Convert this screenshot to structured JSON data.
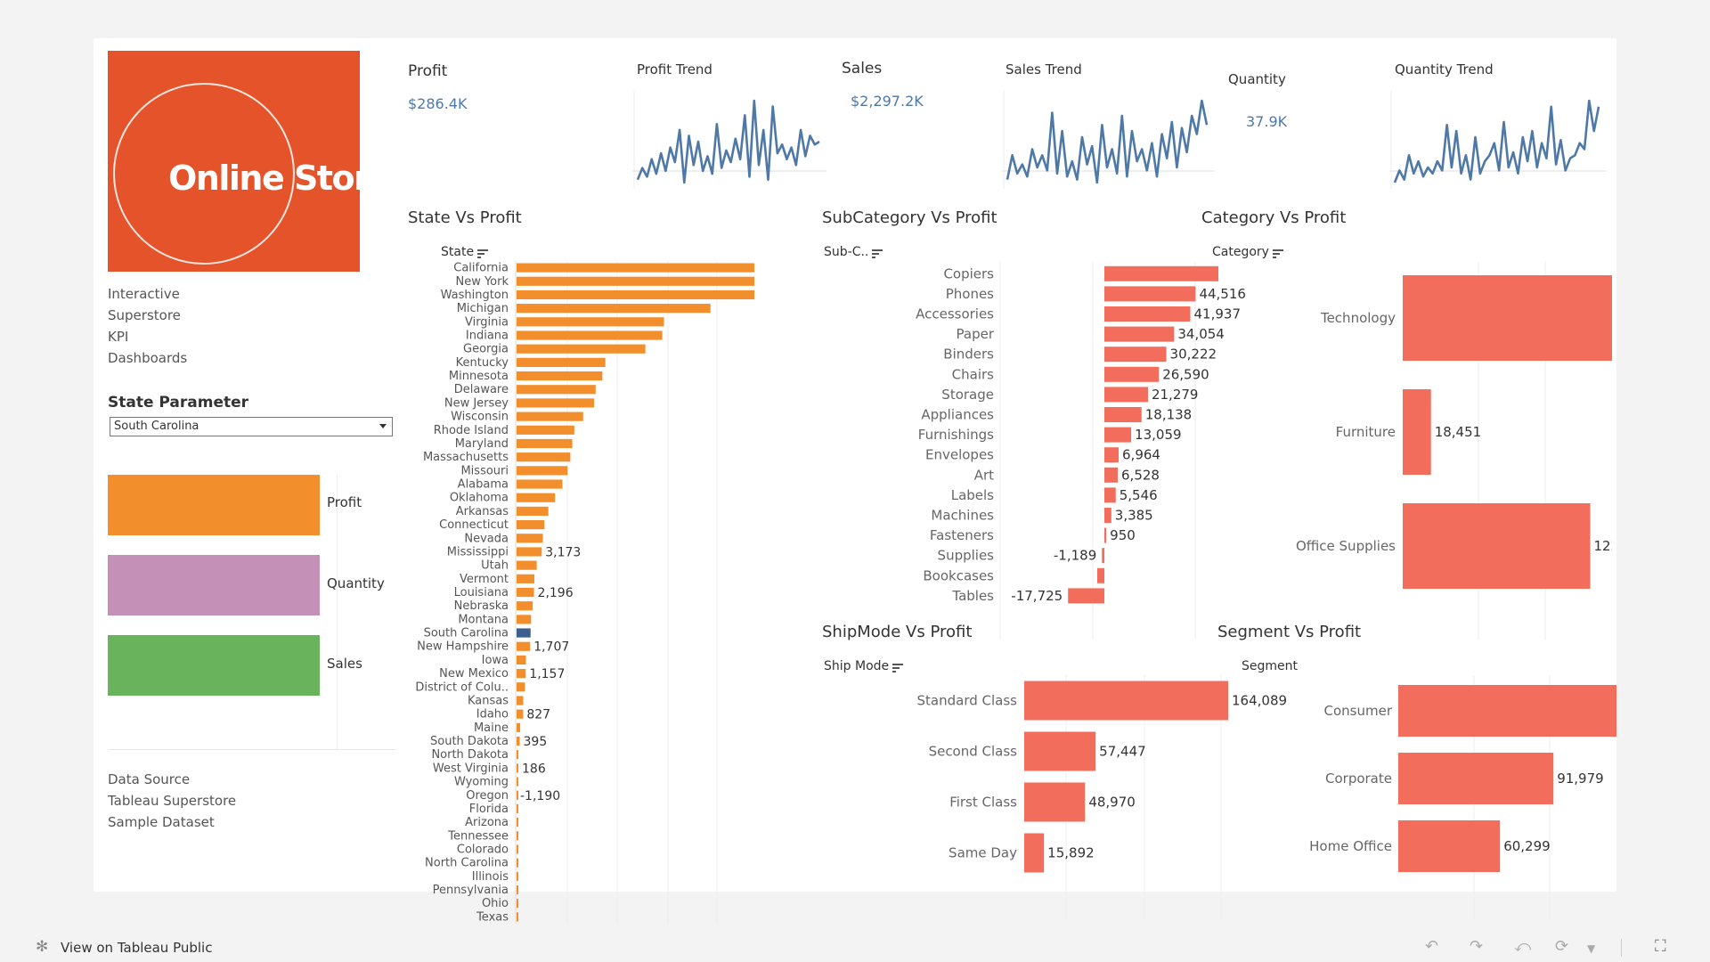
{
  "logo": {
    "text": "Online Store"
  },
  "description": [
    "Interactive",
    "Superstore",
    "KPI",
    "Dashboards"
  ],
  "state_parameter": {
    "title": "State Parameter",
    "selected": "South Carolina"
  },
  "legend": [
    {
      "label": "Profit",
      "color": "#f28e2b"
    },
    {
      "label": "Quantity",
      "color": "#c490b8"
    },
    {
      "label": "Sales",
      "color": "#6ab35d"
    }
  ],
  "data_source": [
    "Data Source",
    "Tableau Superstore",
    "Sample Dataset"
  ],
  "kpis": [
    {
      "title": "Profit",
      "value": "$286.4K",
      "trend_title": "Profit Trend"
    },
    {
      "title": "Sales",
      "value": "$2,297.2K",
      "trend_title": "Sales Trend"
    },
    {
      "title": "Quantity",
      "value": "37.9K",
      "trend_title": "Quantity Trend"
    }
  ],
  "colors": {
    "orange": "#f28e2b",
    "highlight": "#3b5f8f",
    "salmon": "#f26d5b",
    "trend": "#4e79a7"
  },
  "chart_data": [
    {
      "type": "bar",
      "title": "State Vs  Profit",
      "dimension": "State",
      "categories": [
        "California",
        "New York",
        "Washington",
        "Michigan",
        "Virginia",
        "Indiana",
        "Georgia",
        "Kentucky",
        "Minnesota",
        "Delaware",
        "New Jersey",
        "Wisconsin",
        "Rhode Island",
        "Maryland",
        "Massachusetts",
        "Missouri",
        "Alabama",
        "Oklahoma",
        "Arkansas",
        "Connecticut",
        "Nevada",
        "Mississippi",
        "Utah",
        "Vermont",
        "Louisiana",
        "Nebraska",
        "Montana",
        "South Carolina",
        "New Hampshire",
        "Iowa",
        "New Mexico",
        "District of Colu..",
        "Kansas",
        "Idaho",
        "Maine",
        "South Dakota",
        "North Dakota",
        "West Virginia",
        "Wyoming",
        "Oregon",
        "Florida",
        "Arizona",
        "Tennessee",
        "Colorado",
        "North Carolina",
        "Illinois",
        "Pennsylvania",
        "Ohio",
        "Texas"
      ],
      "values": [
        76381,
        74039,
        33403,
        24463,
        18598,
        18383,
        16250,
        11200,
        10823,
        9977,
        9773,
        8402,
        7286,
        7032,
        6786,
        6436,
        5787,
        4854,
        4009,
        3511,
        3317,
        3173,
        2547,
        2245,
        2196,
        2037,
        1834,
        1769,
        1707,
        1184,
        1157,
        1060,
        837,
        827,
        455,
        395,
        230,
        186,
        100,
        -1190,
        -3399,
        -3428,
        -5342,
        -6528,
        -7491,
        -12608,
        -15560,
        -16971,
        -25730
      ],
      "highlight": "South Carolina",
      "data_labels": {
        "Mississippi": "3,173",
        "Louisiana": "2,196",
        "New Hampshire": "1,707",
        "New Mexico": "1,157",
        "Idaho": "827",
        "South Dakota": "395",
        "West Virginia": "186",
        "Oregon": "-1,190"
      }
    },
    {
      "type": "bar",
      "title": "SubCategory Vs Profit",
      "dimension": "Sub-C..",
      "categories": [
        "Copiers",
        "Phones",
        "Accessories",
        "Paper",
        "Binders",
        "Chairs",
        "Storage",
        "Appliances",
        "Furnishings",
        "Envelopes",
        "Art",
        "Labels",
        "Machines",
        "Fasteners",
        "Supplies",
        "Bookcases",
        "Tables"
      ],
      "values": [
        55618,
        44516,
        41937,
        34054,
        30222,
        26590,
        21279,
        18138,
        13059,
        6964,
        6528,
        5546,
        3385,
        950,
        -1189,
        -3473,
        -17725
      ],
      "labels": [
        "",
        "44,516",
        "41,937",
        "34,054",
        "30,222",
        "26,590",
        "21,279",
        "18,138",
        "13,059",
        "6,964",
        "6,528",
        "5,546",
        "3,385",
        "950",
        "-1,189",
        "",
        "-17,725"
      ]
    },
    {
      "type": "bar",
      "title": "Category Vs Profit",
      "dimension": "Category",
      "categories": [
        "Technology",
        "Furniture",
        "Office Supplies"
      ],
      "values": [
        145455,
        18451,
        122491
      ],
      "labels": [
        "145,455",
        "18,451",
        "122,491"
      ]
    },
    {
      "type": "bar",
      "title": "ShipMode Vs  Profit",
      "dimension": "Ship Mode",
      "categories": [
        "Standard Class",
        "Second Class",
        "First Class",
        "Same Day"
      ],
      "values": [
        164089,
        57447,
        48970,
        15892
      ],
      "labels": [
        "164,089",
        "57,447",
        "48,970",
        "15,892"
      ]
    },
    {
      "type": "bar",
      "title": "Segment Vs  Profit",
      "dimension": "Segment",
      "categories": [
        "Consumer",
        "Corporate",
        "Home Office"
      ],
      "values": [
        134119,
        91979,
        60299
      ],
      "labels": [
        "134,119",
        "91,979",
        "60,299"
      ]
    },
    {
      "type": "line",
      "title": "Profit Trend",
      "values": [
        3,
        7,
        4,
        10,
        5,
        12,
        6,
        14,
        9,
        20,
        2,
        18,
        8,
        16,
        6,
        11,
        5,
        22,
        7,
        13,
        9,
        17,
        10,
        25,
        4,
        30,
        8,
        20,
        3,
        28,
        12,
        15,
        10,
        14,
        8,
        20,
        11,
        18,
        15,
        16
      ]
    },
    {
      "type": "line",
      "title": "Sales Trend",
      "values": [
        4,
        12,
        6,
        9,
        5,
        14,
        8,
        12,
        7,
        26,
        6,
        20,
        5,
        10,
        4,
        18,
        9,
        15,
        3,
        22,
        8,
        14,
        6,
        25,
        5,
        20,
        10,
        14,
        7,
        16,
        5,
        19,
        11,
        23,
        8,
        21,
        13,
        25,
        19,
        30,
        22
      ]
    },
    {
      "type": "line",
      "title": "Quantity Trend",
      "values": [
        5,
        9,
        6,
        14,
        8,
        12,
        7,
        10,
        8,
        12,
        9,
        24,
        10,
        22,
        8,
        14,
        6,
        20,
        8,
        12,
        14,
        18,
        9,
        25,
        10,
        15,
        8,
        20,
        12,
        22,
        10,
        18,
        13,
        30,
        11,
        19,
        9,
        13,
        14,
        18,
        16,
        32,
        22,
        30
      ]
    }
  ],
  "footer": {
    "view_label": "View on Tableau Public"
  }
}
